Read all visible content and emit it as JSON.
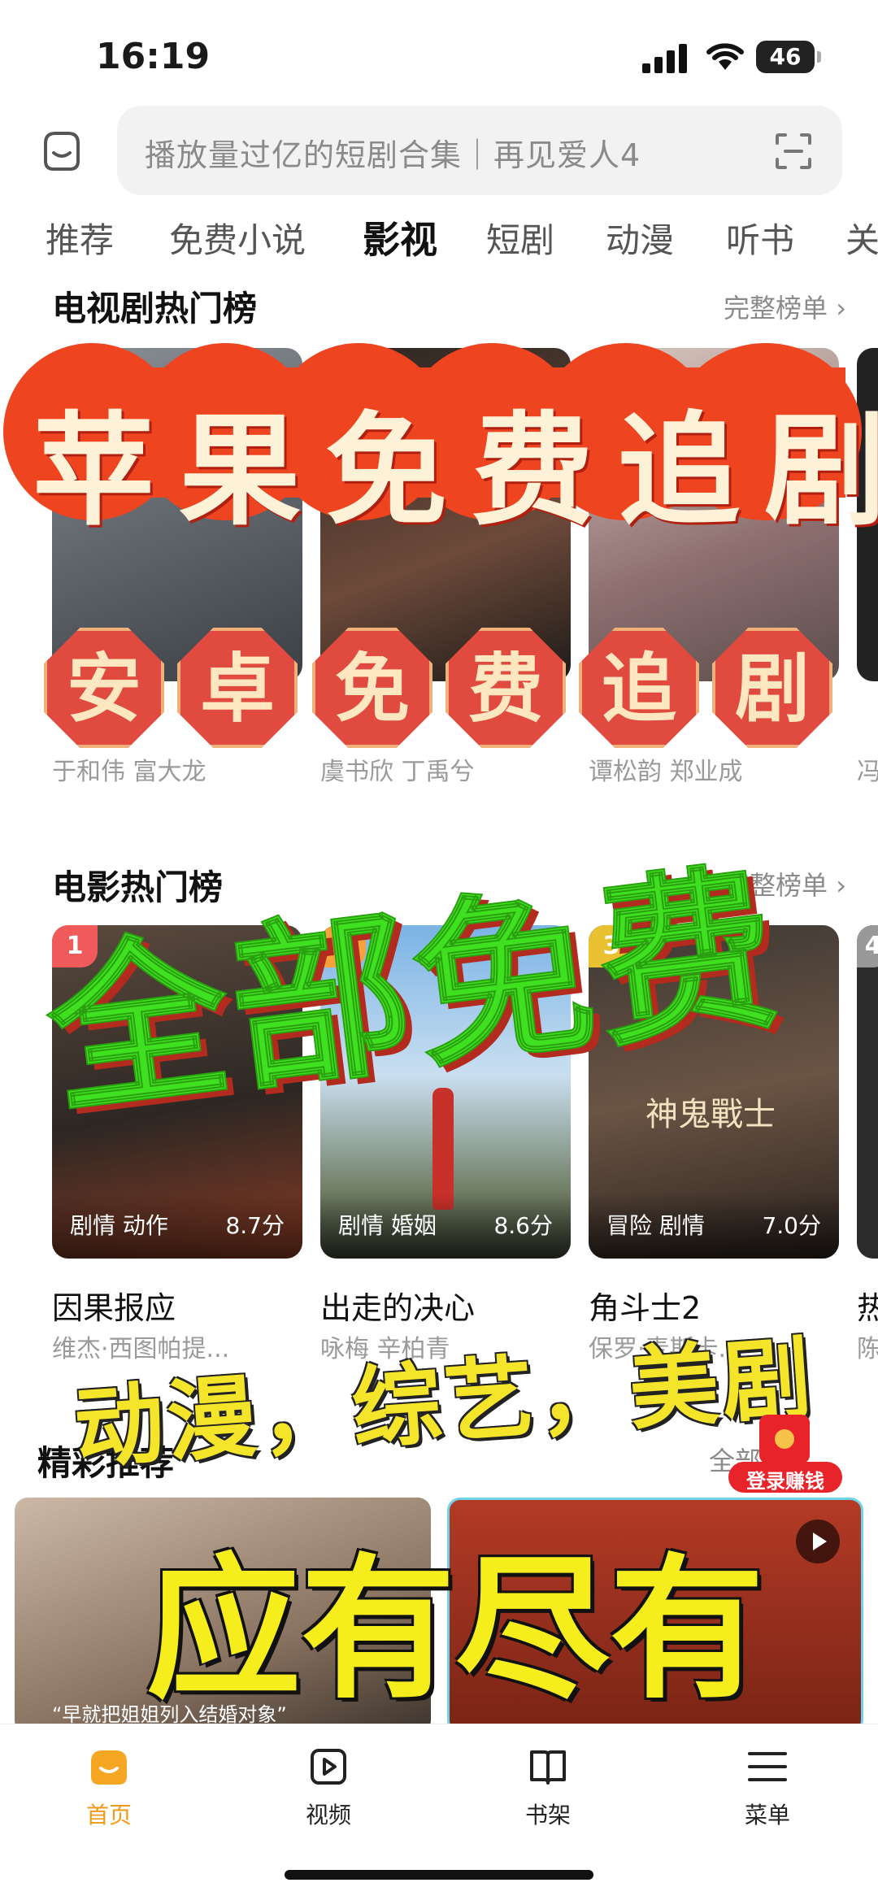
{
  "status_bar": {
    "time": "16:19",
    "battery": "46"
  },
  "search": {
    "placeholder": "播放量过亿的短剧合集｜再见爱人4"
  },
  "tabs": [
    "推荐",
    "免费小说",
    "影视",
    "短剧",
    "动漫",
    "听书",
    "关"
  ],
  "active_tab": "影视",
  "tv_section": {
    "title": "电视剧热门榜",
    "more": "完整榜单",
    "items": [
      {
        "cast": "于和伟 富大龙"
      },
      {
        "cast": "虞书欣 丁禹兮"
      },
      {
        "cast": "谭松韵 郑业成"
      },
      {
        "cast": "冯"
      }
    ]
  },
  "movie_section": {
    "title": "电影热门榜",
    "more": "完整榜单",
    "items": [
      {
        "rank": "1",
        "genre": "剧情 动作",
        "score": "8.7分",
        "title": "因果报应",
        "sub": "维杰·西图帕提..."
      },
      {
        "rank": "2",
        "genre": "剧情 婚姻",
        "score": "8.6分",
        "title": "出走的决心",
        "sub": "咏梅 辛柏青"
      },
      {
        "rank": "3",
        "genre": "冒险 剧情",
        "score": "7.0分",
        "title": "角斗士2",
        "sub": "保罗·麦斯卡..."
      },
      {
        "rank": "4",
        "title": "热",
        "sub": "陈"
      }
    ],
    "poster3_text": "神鬼戰士"
  },
  "recommend_section": {
    "title": "精彩推荐",
    "more": "全部",
    "caption1": "“早就把姐姐列入结婚对象”"
  },
  "badge": {
    "label": "登录赚钱"
  },
  "overlays": {
    "red_banner": "苹果免费追剧",
    "octagon_chars": [
      "安",
      "卓",
      "免",
      "费",
      "追",
      "剧"
    ],
    "green_text": "全部免费",
    "yellow_sub": "动漫，综艺，美剧",
    "yellow_big": "应有尽有"
  },
  "bottom_nav": [
    {
      "label": "首页",
      "icon": "home-icon"
    },
    {
      "label": "视频",
      "icon": "video-icon"
    },
    {
      "label": "书架",
      "icon": "bookshelf-icon"
    },
    {
      "label": "菜单",
      "icon": "menu-icon"
    }
  ],
  "colors": {
    "accent": "#f09b14",
    "rank1": "#f05a5a",
    "rank2": "#f5a23c",
    "rank3": "#e8c030",
    "banner_red": "#ee4420",
    "green": "#3fe01f",
    "yellow": "#f5ee1c"
  }
}
